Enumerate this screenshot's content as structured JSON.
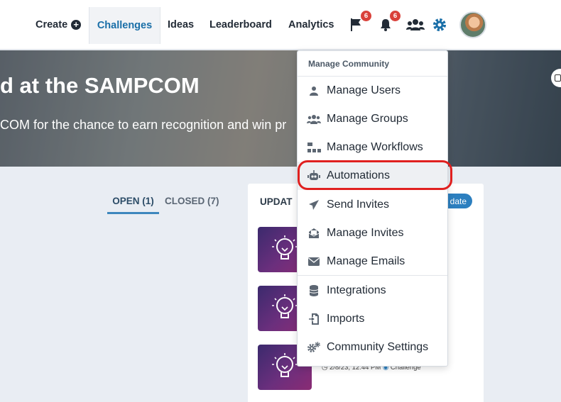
{
  "nav": {
    "create": "Create",
    "challenges": "Challenges",
    "ideas": "Ideas",
    "leaderboard": "Leaderboard",
    "analytics": "Analytics",
    "flag_count": "6",
    "bell_count": "6"
  },
  "hero": {
    "title": "d at the SAMPCOM",
    "subtitle": "COM for the chance to earn recognition and win pr"
  },
  "tabs": {
    "open": "OPEN (1)",
    "closed": "CLOSED (7)"
  },
  "card": {
    "title": "UPDAT",
    "update_button": "date",
    "meta_time": "2/8/23, 12:44 PM",
    "meta_type": "Challenge"
  },
  "menu": {
    "header": "Manage Community",
    "items": [
      {
        "label": "Manage Users",
        "icon": "user-icon"
      },
      {
        "label": "Manage Groups",
        "icon": "users-icon"
      },
      {
        "label": "Manage Workflows",
        "icon": "workflow-icon"
      },
      {
        "label": "Automations",
        "icon": "robot-icon"
      },
      {
        "label": "Send Invites",
        "icon": "paper-plane-icon"
      },
      {
        "label": "Manage Invites",
        "icon": "envelope-open-icon"
      },
      {
        "label": "Manage Emails",
        "icon": "envelope-icon"
      },
      {
        "label": "Integrations",
        "icon": "database-icon"
      },
      {
        "label": "Imports",
        "icon": "import-icon"
      },
      {
        "label": "Community Settings",
        "icon": "gears-icon"
      }
    ]
  },
  "colors": {
    "accent": "#1a6fa8",
    "badge": "#d9413a",
    "highlight_ring": "#e0201f"
  }
}
